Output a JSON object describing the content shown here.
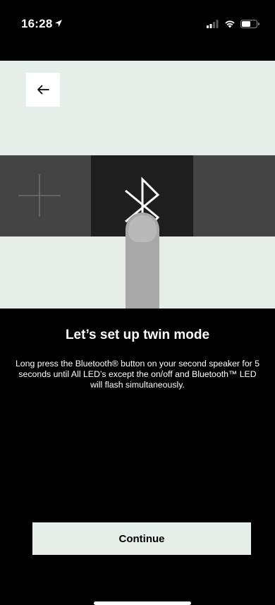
{
  "status_bar": {
    "time": "16:28",
    "location_icon": "location-arrow-icon",
    "signal_icon": "cellular-signal-icon",
    "wifi_icon": "wifi-icon",
    "battery_icon": "battery-icon"
  },
  "illustration": {
    "back_icon": "arrow-left-icon",
    "speaker_icons": [
      "plus-icon",
      "bluetooth-icon"
    ],
    "gesture_icon": "finger-press"
  },
  "content": {
    "heading": "Let’s set up twin mode",
    "instructions": "Long press the Bluetooth® button on your second speaker for 5 seconds until All LED’s except the on/off and Bluetooth™ LED will flash simultaneously."
  },
  "actions": {
    "continue_label": "Continue"
  },
  "colors": {
    "background": "#000000",
    "illustration_background": "#e6eeea",
    "speaker_dark": "#1e1e1e",
    "speaker_gray": "#444444",
    "button_background": "#e6eeea",
    "text_primary": "#ffffff"
  }
}
